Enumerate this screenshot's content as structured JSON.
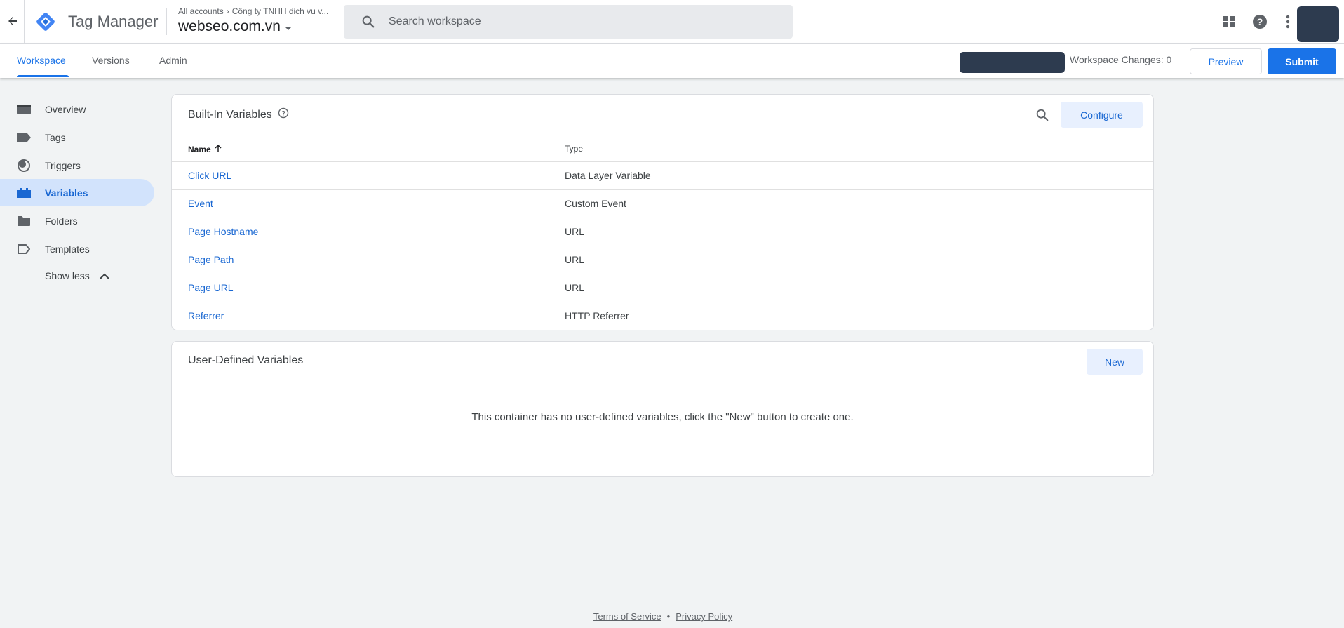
{
  "header": {
    "product_name": "Tag Manager",
    "breadcrumb_root": "All accounts",
    "breadcrumb_account": "Công ty TNHH dịch vụ v...",
    "container_name": "webseo.com.vn",
    "search_placeholder": "Search workspace"
  },
  "tabs": [
    {
      "label": "Workspace",
      "active": true
    },
    {
      "label": "Versions",
      "active": false
    },
    {
      "label": "Admin",
      "active": false
    }
  ],
  "subbar": {
    "workspace_changes": "Workspace Changes: 0",
    "preview_label": "Preview",
    "submit_label": "Submit"
  },
  "sidebar": {
    "items": [
      {
        "label": "Overview",
        "icon": "overview-icon",
        "active": false
      },
      {
        "label": "Tags",
        "icon": "tag-icon",
        "active": false
      },
      {
        "label": "Triggers",
        "icon": "trigger-icon",
        "active": false
      },
      {
        "label": "Variables",
        "icon": "variables-icon",
        "active": true
      },
      {
        "label": "Folders",
        "icon": "folder-icon",
        "active": false
      },
      {
        "label": "Templates",
        "icon": "template-icon",
        "active": false
      }
    ],
    "show_less": "Show less"
  },
  "builtin": {
    "title": "Built-In Variables",
    "configure_label": "Configure",
    "col_name": "Name",
    "col_type": "Type",
    "rows": [
      {
        "name": "Click URL",
        "type": "Data Layer Variable"
      },
      {
        "name": "Event",
        "type": "Custom Event"
      },
      {
        "name": "Page Hostname",
        "type": "URL"
      },
      {
        "name": "Page Path",
        "type": "URL"
      },
      {
        "name": "Page URL",
        "type": "URL"
      },
      {
        "name": "Referrer",
        "type": "HTTP Referrer"
      }
    ]
  },
  "userdefined": {
    "title": "User-Defined Variables",
    "new_label": "New",
    "empty_message": "This container has no user-defined variables, click the \"New\" button to create one."
  },
  "footer": {
    "terms": "Terms of Service",
    "separator": "•",
    "privacy": "Privacy Policy"
  },
  "colors": {
    "accent": "#1a73e8",
    "active_nav_bg": "#d2e3fc",
    "redacted": "#2d3b4f"
  }
}
